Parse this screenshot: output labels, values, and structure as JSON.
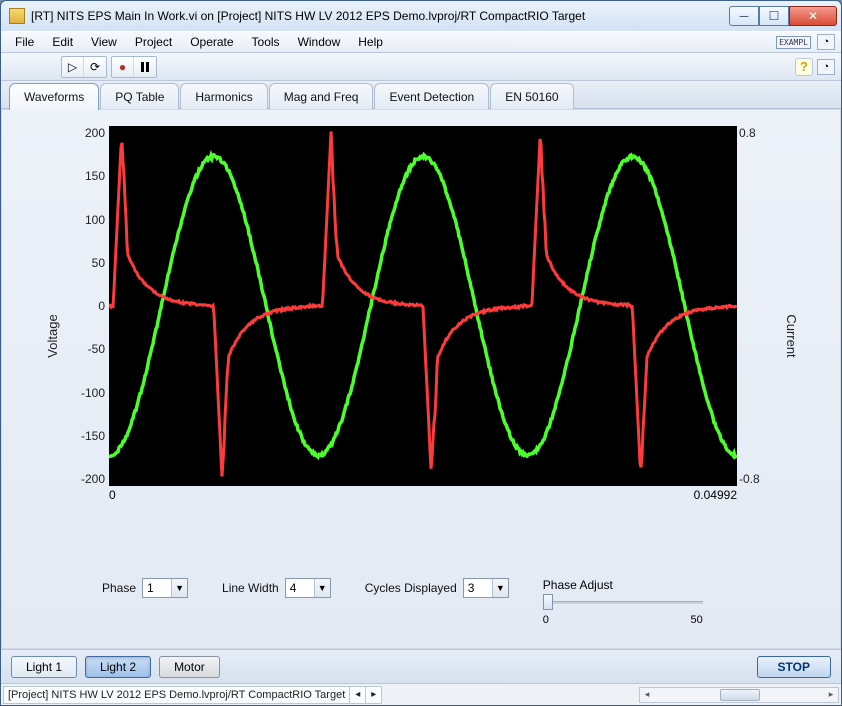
{
  "window": {
    "title": "[RT] NITS EPS Main In Work.vi on [Project] NITS HW LV 2012 EPS Demo.lvproj/RT CompactRIO Target"
  },
  "menu": {
    "items": [
      "File",
      "Edit",
      "View",
      "Project",
      "Operate",
      "Tools",
      "Window",
      "Help"
    ],
    "exampl_label": "EXAMPL"
  },
  "tabs": {
    "items": [
      "Waveforms",
      "PQ Table",
      "Harmonics",
      "Mag and Freq",
      "Event Detection",
      "EN 50160"
    ],
    "active_index": 0
  },
  "chart_data": {
    "type": "line",
    "x_range": [
      0,
      0.04992
    ],
    "left_axis": {
      "label": "Voltage",
      "range": [
        -200,
        200
      ],
      "ticks": [
        200,
        150,
        100,
        50,
        0,
        -50,
        -100,
        -150,
        -200
      ]
    },
    "right_axis": {
      "label": "Current",
      "range": [
        -0.8,
        0.8
      ],
      "ticks_top": "0.8",
      "ticks_bottom": "-0.8"
    },
    "x_ticks": [
      "0",
      "0.04992"
    ],
    "series": [
      {
        "name": "voltage",
        "color": "#4bff2b",
        "cycles": 3,
        "amplitude_frac": 0.83,
        "phase_deg": -90,
        "noise": 0.01
      },
      {
        "name": "current",
        "color": "#ff3a3a",
        "cycles": 3,
        "shape": "rectified-spike",
        "spike_frac": 0.95,
        "tail_frac": 0.08,
        "noise": 0.02
      }
    ]
  },
  "controls": {
    "phase": {
      "label": "Phase",
      "value": "1"
    },
    "line_width": {
      "label": "Line Width",
      "value": "4"
    },
    "cycles_displayed": {
      "label": "Cycles Displayed",
      "value": "3"
    },
    "phase_adjust": {
      "label": "Phase Adjust",
      "min": "0",
      "max": "50",
      "value": 0
    }
  },
  "footer": {
    "light1": "Light 1",
    "light2": "Light 2",
    "motor": "Motor",
    "stop": "STOP"
  },
  "status": {
    "text": "[Project] NITS HW LV 2012 EPS Demo.lvproj/RT CompactRIO Target"
  }
}
